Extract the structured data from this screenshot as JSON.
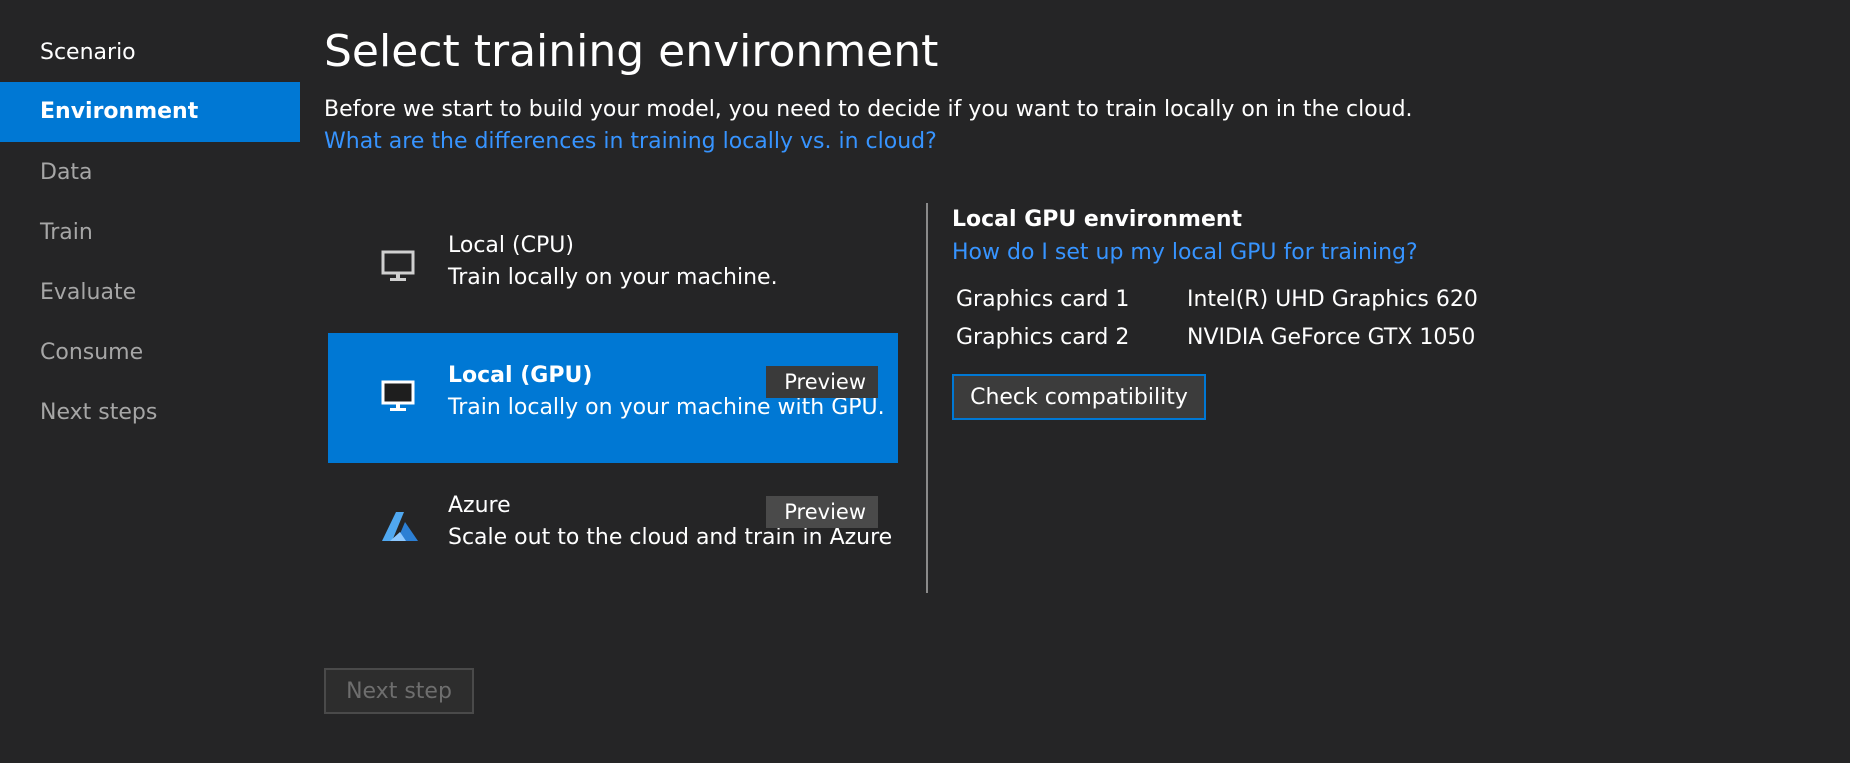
{
  "sidebar": {
    "items": [
      {
        "label": "Scenario"
      },
      {
        "label": "Environment"
      },
      {
        "label": "Data"
      },
      {
        "label": "Train"
      },
      {
        "label": "Evaluate"
      },
      {
        "label": "Consume"
      },
      {
        "label": "Next steps"
      }
    ],
    "active_index": 1
  },
  "main": {
    "title": "Select training environment",
    "subtitle": "Before we start to build your model, you need to decide if you want to train locally on in the cloud.",
    "differences_link": "What are the differences in training locally vs. in cloud?"
  },
  "options": [
    {
      "title": "Local (CPU)",
      "description": "Train locally on your machine.",
      "icon": "monitor-icon",
      "badge": "",
      "selected": false
    },
    {
      "title": "Local (GPU)",
      "description": "Train locally on your machine with GPU.",
      "icon": "monitor-icon",
      "badge": "Preview",
      "selected": true
    },
    {
      "title": "Azure",
      "description": "Scale out to the cloud and train in Azure",
      "icon": "azure-icon",
      "badge": "Preview",
      "selected": false
    }
  ],
  "panel": {
    "title": "Local GPU environment",
    "setup_link": "How do I set up my local GPU for training?",
    "cards": [
      {
        "label": "Graphics card 1",
        "value": "Intel(R) UHD Graphics 620"
      },
      {
        "label": "Graphics card 2",
        "value": "NVIDIA GeForce GTX 1050"
      }
    ],
    "check_button": "Check compatibility"
  },
  "footer": {
    "next_button": "Next step"
  },
  "colors": {
    "background": "#252526",
    "accent": "#0078d4",
    "link": "#3794ff",
    "muted_text": "#a6a6a6",
    "badge": "#4a4a4a"
  }
}
